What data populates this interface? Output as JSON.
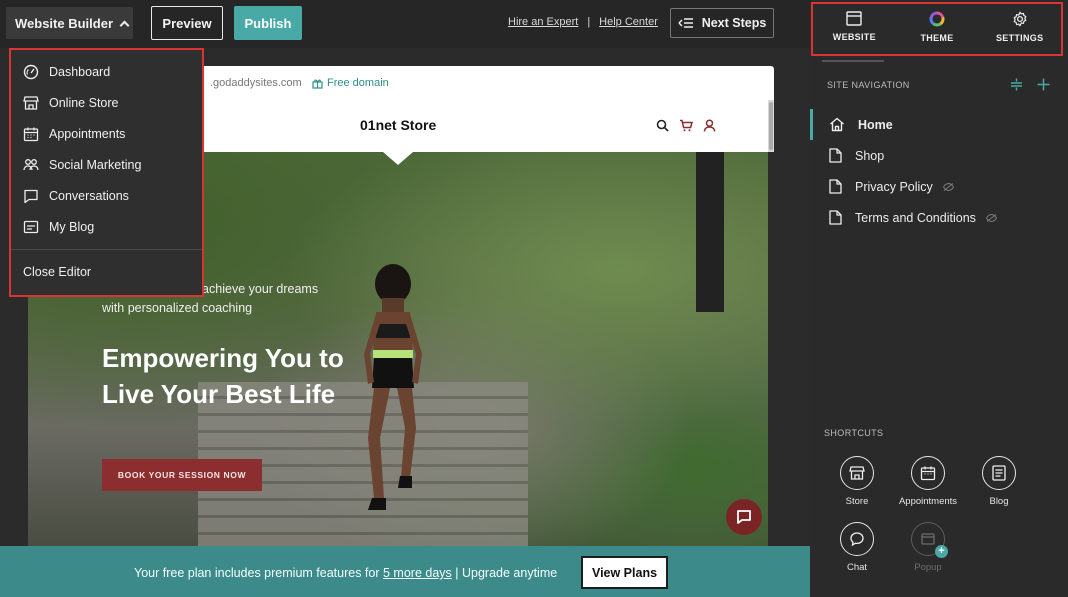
{
  "topbar": {
    "builder_label": "Website Builder",
    "preview_label": "Preview",
    "publish_label": "Publish",
    "hire_link": "Hire an Expert",
    "separator": "|",
    "help_link": "Help Center",
    "next_steps_label": "Next Steps"
  },
  "dropdown": {
    "items": [
      {
        "label": "Dashboard",
        "icon": "dashboard-icon"
      },
      {
        "label": "Online Store",
        "icon": "store-icon"
      },
      {
        "label": "Appointments",
        "icon": "calendar-icon"
      },
      {
        "label": "Social Marketing",
        "icon": "people-icon"
      },
      {
        "label": "Conversations",
        "icon": "chat-icon"
      },
      {
        "label": "My Blog",
        "icon": "blog-icon"
      }
    ],
    "close_label": "Close Editor"
  },
  "site": {
    "domain": ".godaddysites.com",
    "free_domain": "Free domain",
    "title": "01net Store",
    "hero_subtitle": "…er strength and achieve your dreams with personalized coaching",
    "hero_title": "Empowering You to Live Your Best Life",
    "cta": "BOOK YOUR SESSION NOW"
  },
  "banner": {
    "text_before": "Your free plan includes premium features for",
    "link": "5 more days",
    "separator": "|",
    "text_after": "Upgrade anytime",
    "button": "View Plans"
  },
  "panel": {
    "tabs": [
      {
        "label": "WEBSITE",
        "icon": "browser-icon"
      },
      {
        "label": "THEME",
        "icon": "palette-icon"
      },
      {
        "label": "SETTINGS",
        "icon": "gear-icon"
      }
    ],
    "site_nav_header": "SITE NAVIGATION",
    "nav": [
      {
        "label": "Home",
        "icon": "home-icon",
        "active": true,
        "hidden": false
      },
      {
        "label": "Shop",
        "icon": "page-icon",
        "active": false,
        "hidden": false
      },
      {
        "label": "Privacy Policy",
        "icon": "page-icon",
        "active": false,
        "hidden": true
      },
      {
        "label": "Terms and Conditions",
        "icon": "page-icon",
        "active": false,
        "hidden": true
      }
    ],
    "shortcuts_header": "SHORTCUTS",
    "shortcuts": [
      {
        "label": "Store",
        "icon": "store-icon"
      },
      {
        "label": "Appointments",
        "icon": "calendar-icon"
      },
      {
        "label": "Blog",
        "icon": "blog-icon"
      },
      {
        "label": "Chat",
        "icon": "chat-icon"
      },
      {
        "label": "Popup",
        "icon": "popup-icon",
        "disabled": true
      }
    ]
  },
  "colors": {
    "accent": "#48a9a6",
    "highlight_border": "#d93434",
    "cta": "#8c2d2f",
    "banner": "#3d8a8a"
  }
}
